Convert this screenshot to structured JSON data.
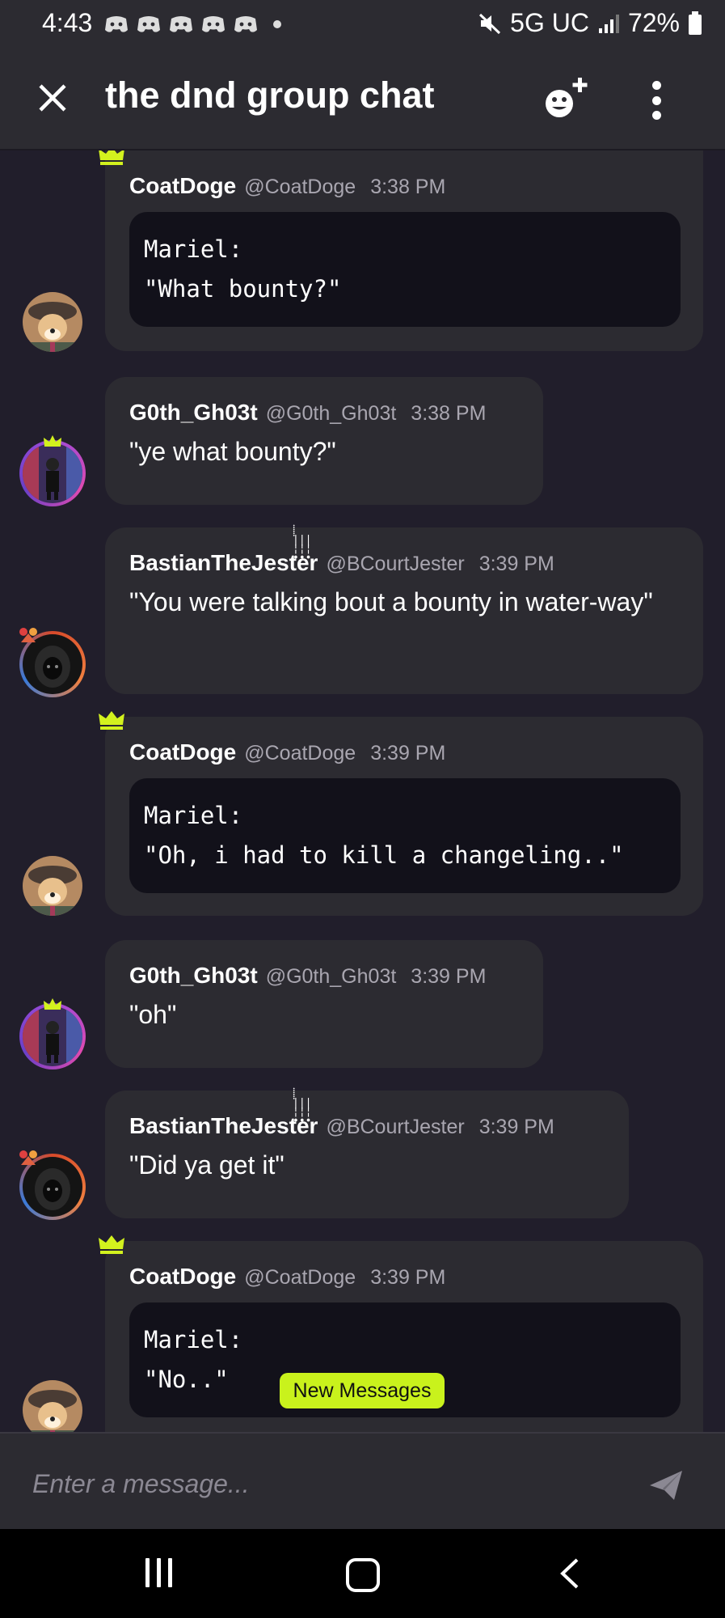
{
  "status_bar": {
    "time": "4:43",
    "network": "5G UC",
    "battery": "72%",
    "notification_icons": [
      "discord-icon",
      "discord-icon",
      "discord-icon",
      "discord-icon",
      "discord-icon"
    ]
  },
  "header": {
    "title": "the dnd group chat",
    "close_icon": "close-icon",
    "add_member_icon": "add-member-icon",
    "menu_icon": "more-vert-icon"
  },
  "messages": [
    {
      "username": "CoatDoge",
      "handle": "@CoatDoge",
      "time": "3:38 PM",
      "crown": true,
      "code": "Mariel:\n\"What bounty?\""
    },
    {
      "username": "G0th_Gh03t",
      "handle": "@G0th_Gh03t",
      "time": "3:38 PM",
      "text": "\"ye what bounty?\""
    },
    {
      "username": "BastianTheJester",
      "handle": "@BCourtJester",
      "time": "3:39 PM",
      "text": "\"You were talking bout a bounty in water-way\""
    },
    {
      "username": "CoatDoge",
      "handle": "@CoatDoge",
      "time": "3:39 PM",
      "crown": true,
      "code": "Mariel:\n\"Oh, i had to kill a changeling..\""
    },
    {
      "username": "G0th_Gh03t",
      "handle": "@G0th_Gh03t",
      "time": "3:39 PM",
      "text": "\"oh\""
    },
    {
      "username": "BastianTheJester",
      "handle": "@BCourtJester",
      "time": "3:39 PM",
      "text": "\"Did ya get it\""
    },
    {
      "username": "CoatDoge",
      "handle": "@CoatDoge",
      "time": "3:39 PM",
      "crown": true,
      "code": "Mariel:\n\"No..\""
    }
  ],
  "new_messages_label": "New Messages",
  "composer": {
    "placeholder": "Enter a message...",
    "send_icon": "send-icon"
  },
  "nav_bar": {
    "recents_icon": "recents-icon",
    "home_icon": "home-icon",
    "back_icon": "back-icon"
  },
  "colors": {
    "background": "#211e2b",
    "bubble": "#2c2b31",
    "code_block": "#12111a",
    "crown": "#d3f21e",
    "new_messages_badge": "#c9f21c",
    "muted_text": "#a9a6b0"
  }
}
